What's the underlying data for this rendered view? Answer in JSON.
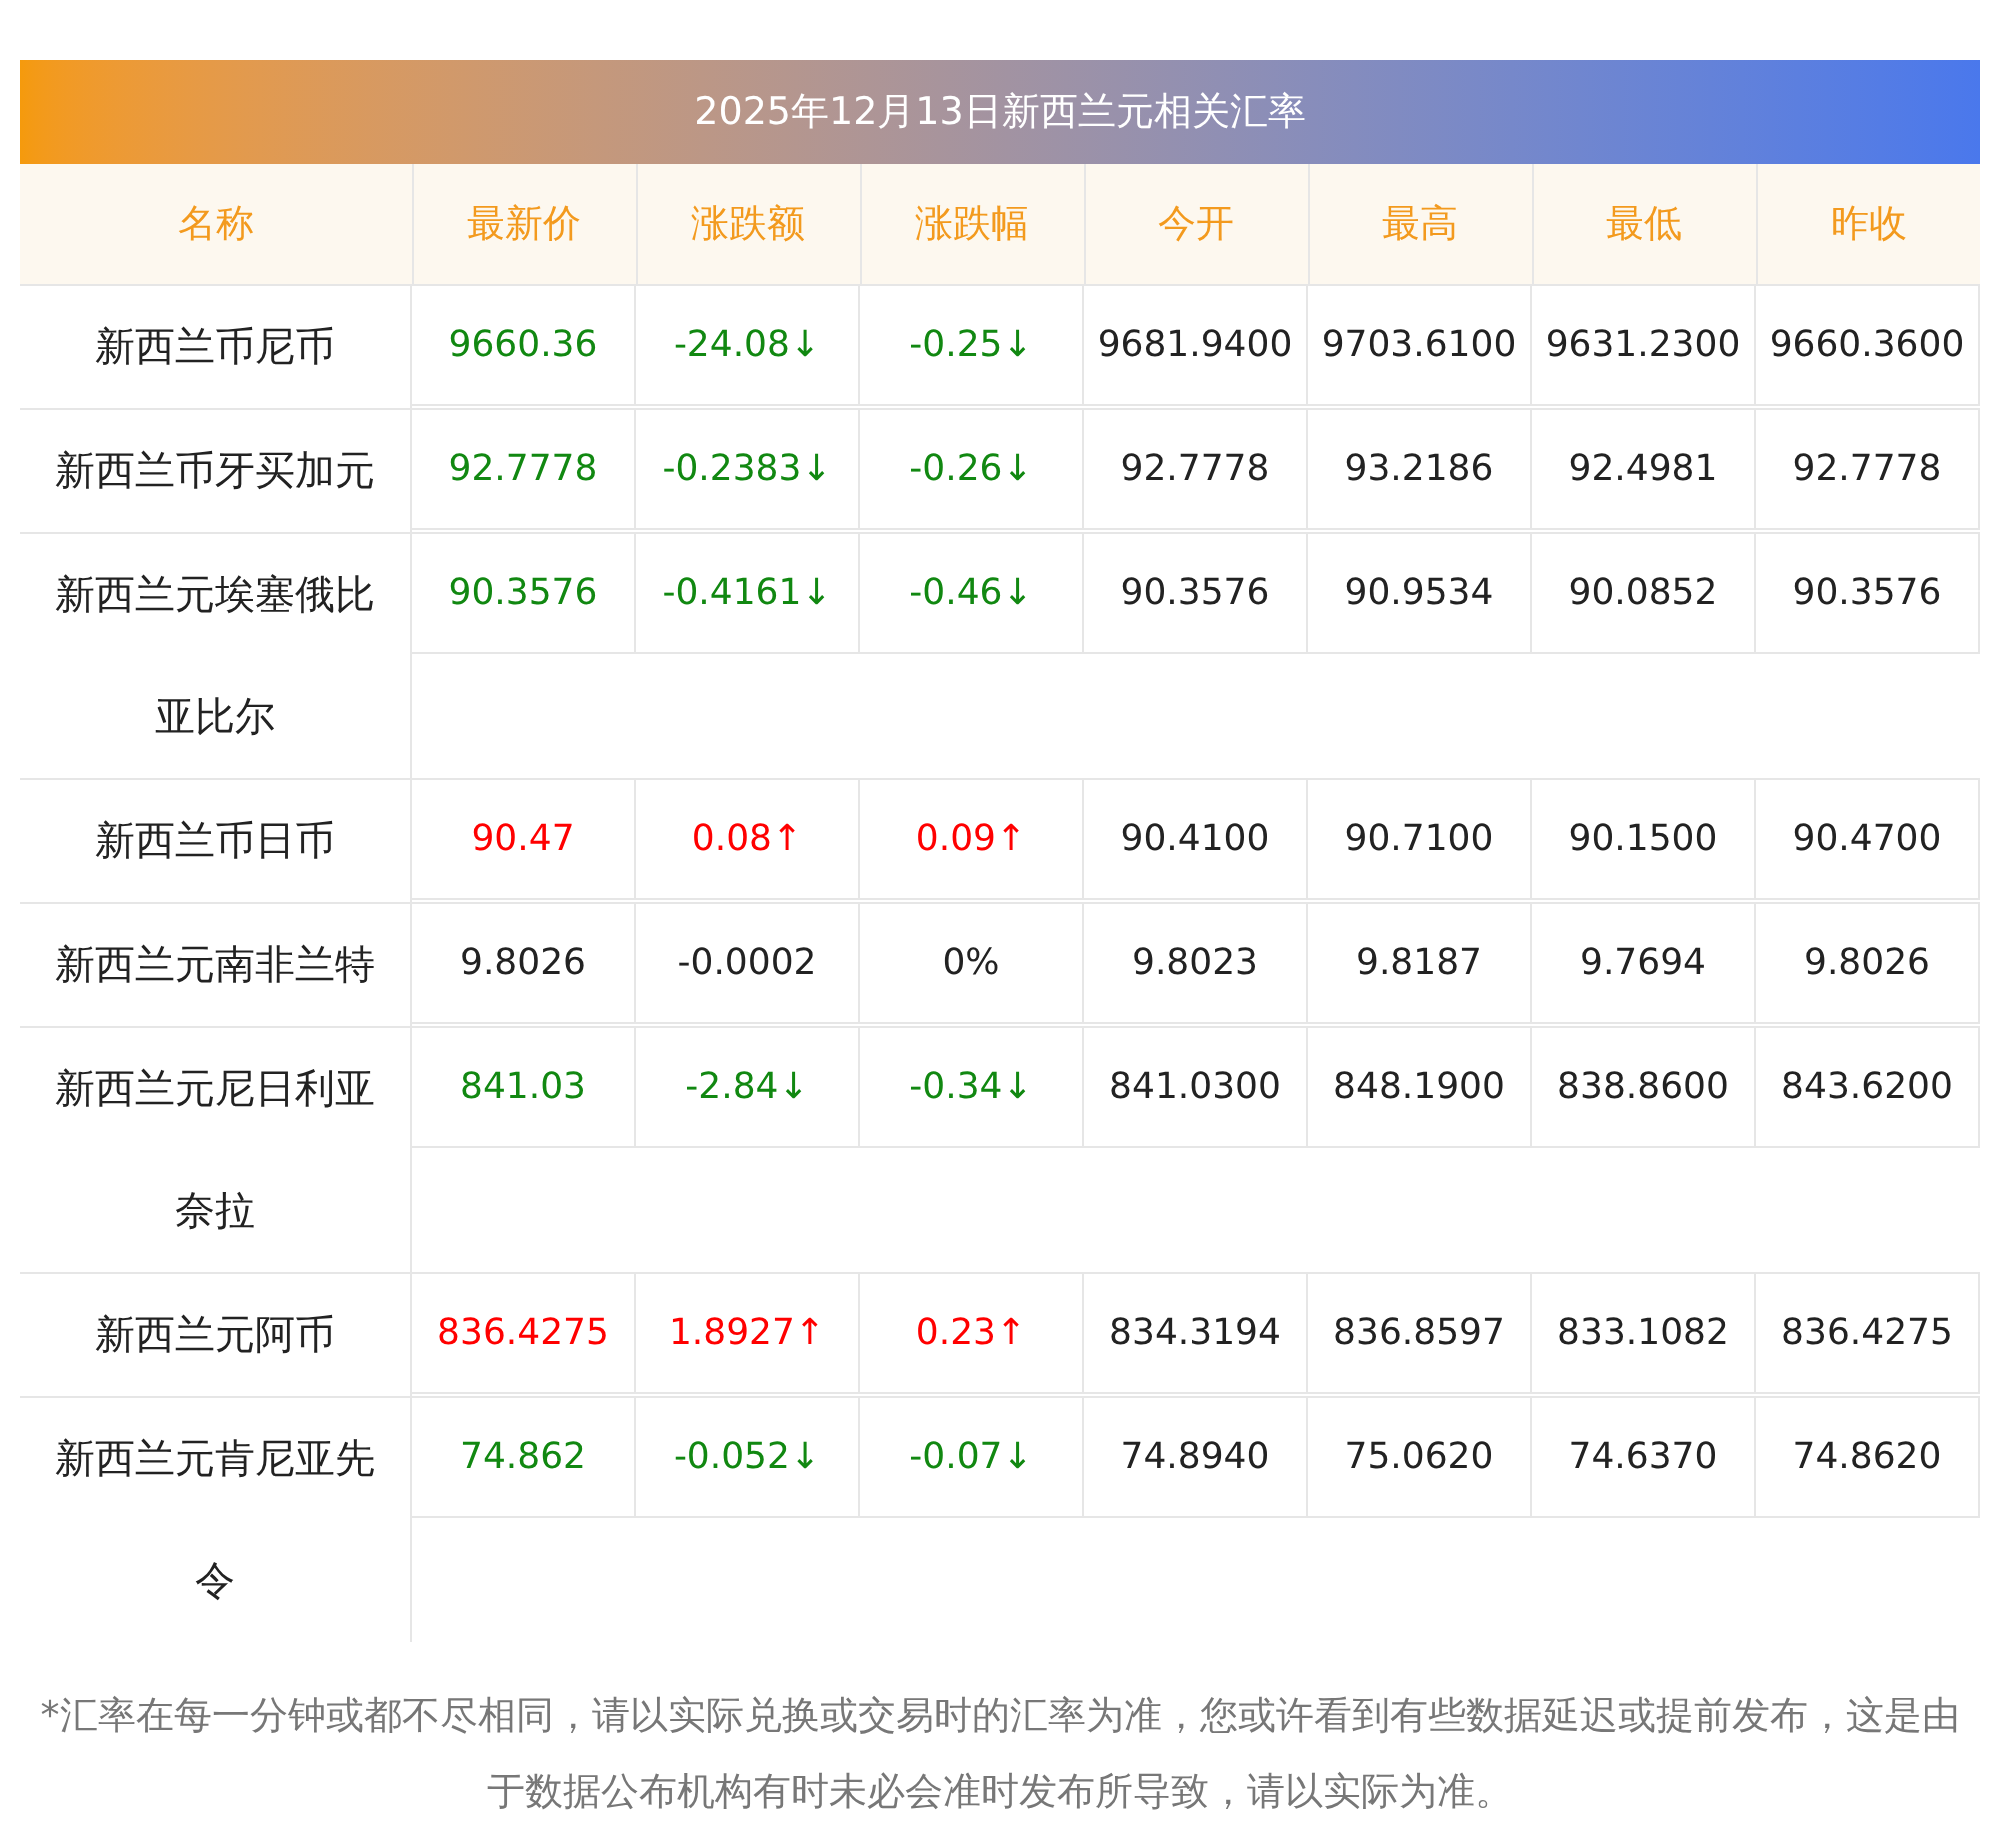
{
  "title": "2025年12月13日新西兰元相关汇率",
  "table": {
    "columns": [
      "名称",
      "最新价",
      "涨跌额",
      "涨跌幅",
      "今开",
      "最高",
      "最低",
      "昨收"
    ],
    "rows": [
      {
        "color": "#118811",
        "cells": [
          "新西兰币尼币",
          "9660.36",
          "-24.08↓",
          "-0.25↓",
          "9681.9400",
          "9703.6100",
          "9631.2300",
          "9660.3600"
        ]
      },
      {
        "color": "#118811",
        "cells": [
          "新西兰币牙买加元",
          "92.7778",
          "-0.2383↓",
          "-0.26↓",
          "92.7778",
          "93.2186",
          "92.4981",
          "92.7778"
        ]
      },
      {
        "color": "#118811",
        "cells": [
          "新西兰元埃塞俄比亚比尔",
          "90.3576",
          "-0.4161↓",
          "-0.46↓",
          "90.3576",
          "90.9534",
          "90.0852",
          "90.3576"
        ]
      },
      {
        "color": "#ff0000",
        "cells": [
          "新西兰币日币",
          "90.47",
          "0.08↑",
          "0.09↑",
          "90.4100",
          "90.7100",
          "90.1500",
          "90.4700"
        ]
      },
      {
        "color": "#222222",
        "cells": [
          "新西兰元南非兰特",
          "9.8026",
          "-0.0002",
          "0%",
          "9.8023",
          "9.8187",
          "9.7694",
          "9.8026"
        ]
      },
      {
        "color": "#118811",
        "cells": [
          "新西兰元尼日利亚奈拉",
          "841.03",
          "-2.84↓",
          "-0.34↓",
          "841.0300",
          "848.1900",
          "838.8600",
          "843.6200"
        ]
      },
      {
        "color": "#ff0000",
        "cells": [
          "新西兰元阿币",
          "836.4275",
          "1.8927↑",
          "0.23↑",
          "834.3194",
          "836.8597",
          "833.1082",
          "836.4275"
        ]
      },
      {
        "color": "#118811",
        "cells": [
          "新西兰元肯尼亚先令",
          "74.862",
          "-0.052↓",
          "-0.07↓",
          "74.8940",
          "75.0620",
          "74.6370",
          "74.8620"
        ]
      }
    ]
  },
  "footnote": "*汇率在每一分钟或都不尽相同，请以实际兑换或交易时的汇率为准，您或许看到有些数据延迟或提前发布，这是由于数据公布机构有时未必会准时发布所导致，请以实际为准。"
}
